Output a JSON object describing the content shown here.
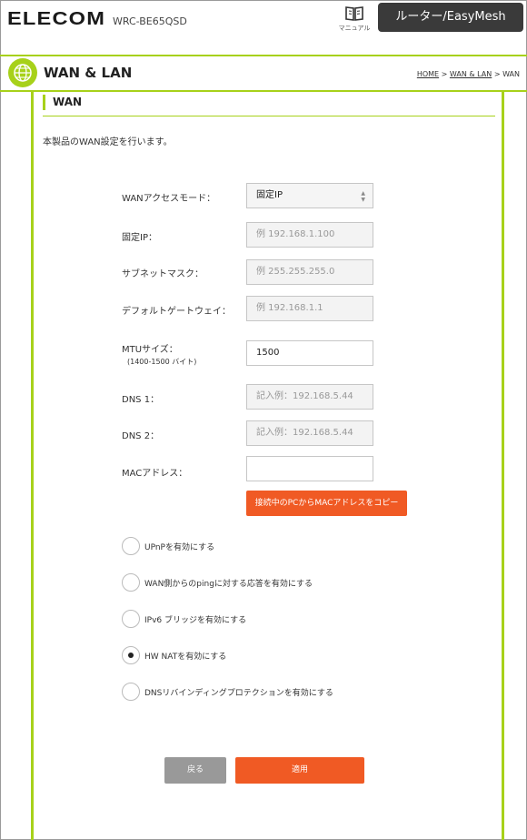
{
  "header": {
    "logo": "ELECOM",
    "model": "WRC-BE65QSD",
    "manual_label": "マニュアル",
    "router_button": "ルーター/EasyMesh"
  },
  "page": {
    "title": "WAN & LAN",
    "breadcrumb": [
      "HOME",
      "WAN & LAN",
      "WAN"
    ]
  },
  "section": {
    "title": "WAN",
    "description": "本製品のWAN設定を行います。"
  },
  "form": {
    "wan_mode": {
      "label": "WANアクセスモード：",
      "value": "固定IP"
    },
    "static_ip": {
      "label": "固定IP：",
      "placeholder": "例 192.168.1.100"
    },
    "subnet": {
      "label": "サブネットマスク：",
      "placeholder": "例 255.255.255.0"
    },
    "gateway": {
      "label": "デフォルトゲートウェイ：",
      "placeholder": "例 192.168.1.1"
    },
    "mtu": {
      "label": "MTUサイズ：",
      "sublabel": "(1400-1500 バイト)",
      "value": "1500"
    },
    "dns1": {
      "label": "DNS 1：",
      "placeholder": "記入例：192.168.5.44"
    },
    "dns2": {
      "label": "DNS 2：",
      "placeholder": "記入例：192.168.5.44"
    },
    "mac": {
      "label": "MACアドレス：",
      "value": ""
    },
    "copy_mac_button": "接続中のPCからMACアドレスをコピー"
  },
  "options": [
    {
      "label": "UPnPを有効にする",
      "checked": false
    },
    {
      "label": "WAN側からのpingに対する応答を有効にする",
      "checked": false
    },
    {
      "label": "IPv6 ブリッジを有効にする",
      "checked": false
    },
    {
      "label": "HW NATを有効にする",
      "checked": true
    },
    {
      "label": "DNSリバインディングプロテクションを有効にする",
      "checked": false
    }
  ],
  "buttons": {
    "back": "戻る",
    "apply": "適用"
  },
  "colors": {
    "accent": "#a7d11a",
    "primary_button": "#f05a24",
    "dark_button": "#3a3a3a",
    "back_button": "#999999"
  }
}
